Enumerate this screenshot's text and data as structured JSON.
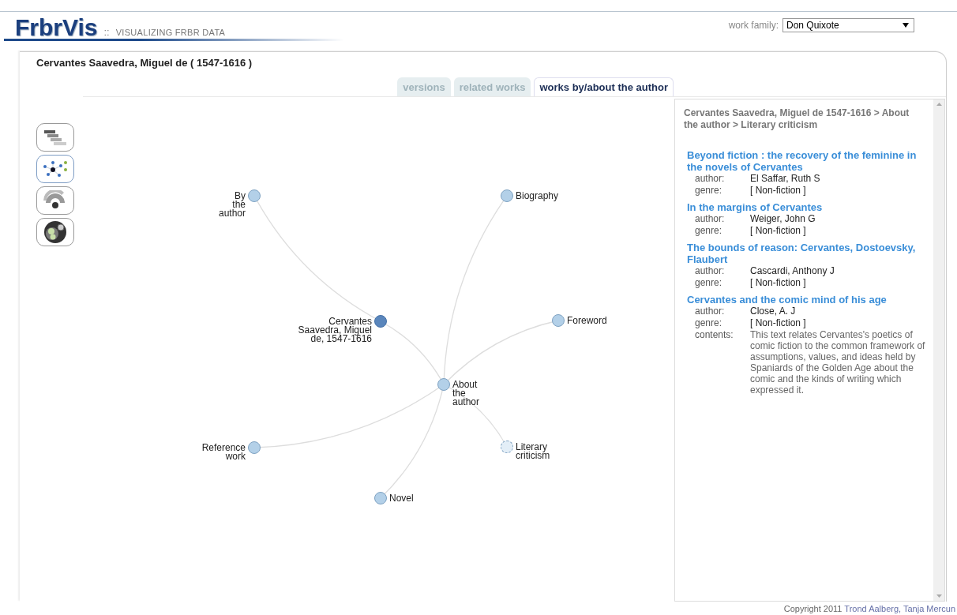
{
  "header": {
    "logo": "FrbrVis",
    "separator": "::",
    "tagline": "VISUALIZING FRBR DATA",
    "work_family_label": "work family:",
    "work_family": "Don Quixote"
  },
  "person": "Cervantes Saavedra, Miguel de ( 1547-1616 )",
  "tabs": [
    {
      "label": "versions",
      "selected": false
    },
    {
      "label": "related works",
      "selected": false
    },
    {
      "label": "works by/about the author",
      "selected": true
    }
  ],
  "view_buttons": [
    {
      "kind": "timeline",
      "selected": false
    },
    {
      "kind": "network",
      "selected": true
    },
    {
      "kind": "radial",
      "selected": false
    },
    {
      "kind": "bubbles",
      "selected": false
    }
  ],
  "graph": {
    "label": "Cervantes Saavedra, Miguel de, 1547-1616",
    "selected": false,
    "children": [
      {
        "label": "By the author",
        "selected": false
      },
      {
        "label": "About the author",
        "selected": false,
        "children": [
          {
            "label": "Biography",
            "selected": false
          },
          {
            "label": "Foreword",
            "selected": false
          },
          {
            "label": "Literary criticism",
            "selected": true
          },
          {
            "label": "Novel",
            "selected": false
          },
          {
            "label": "Reference work",
            "selected": false
          }
        ]
      }
    ]
  },
  "details": {
    "breadcrumb": "Cervantes Saavedra, Miguel de 1547-1616 > About the author > Literary criticism",
    "works": [
      {
        "title": "Beyond fiction : the recovery of the feminine in the novels of Cervantes",
        "fields": [
          {
            "label": "author:",
            "value": "El Saffar, Ruth S",
            "kind": "text"
          },
          {
            "label": "genre:",
            "value": "[ Non-fiction ]",
            "kind": "text"
          }
        ]
      },
      {
        "title": "In the margins of Cervantes",
        "fields": [
          {
            "label": "author:",
            "value": "Weiger, John G",
            "kind": "text"
          },
          {
            "label": "genre:",
            "value": "[ Non-fiction ]",
            "kind": "text"
          }
        ]
      },
      {
        "title": "The bounds of reason: Cervantes, Dostoevsky, Flaubert",
        "fields": [
          {
            "label": "author:",
            "value": "Cascardi, Anthony J",
            "kind": "text"
          },
          {
            "label": "genre:",
            "value": "[ Non-fiction ]",
            "kind": "text"
          }
        ]
      },
      {
        "title": "Cervantes and the comic mind of his age",
        "fields": [
          {
            "label": "author:",
            "value": "Close, A. J",
            "kind": "text"
          },
          {
            "label": "genre:",
            "value": "[ Non-fiction ]",
            "kind": "text"
          },
          {
            "label": "contents:",
            "value": "This text relates Cervantes's poetics of comic fiction to the common framework of assumptions, values, and ideas held by Spaniards of the Golden Age about the comic and the kinds of writing which expressed it.",
            "kind": "note"
          }
        ]
      }
    ]
  },
  "footer": {
    "text": "Copyright 2011",
    "authors": "Trond Aalberg, Tanja Mercun"
  }
}
